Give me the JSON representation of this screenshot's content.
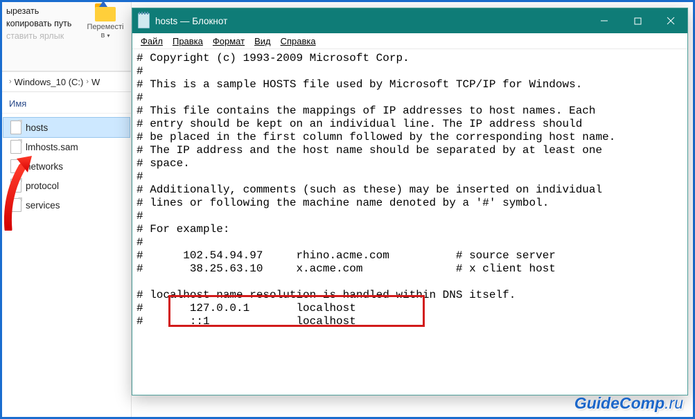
{
  "explorer": {
    "ribbon": {
      "cut": "ырезать",
      "copy_path": "копировать путь",
      "paste_shortcut": "ставить ярлык",
      "move_to": "Переместі",
      "move_to_line2": "в",
      "dropdown": "▾"
    },
    "breadcrumb": {
      "items": [
        "Windows_10 (C:)",
        "W"
      ]
    },
    "column_header": "Имя",
    "files": [
      {
        "name": "hosts",
        "type": "file",
        "selected": true
      },
      {
        "name": "lmhosts.sam",
        "type": "file",
        "selected": false
      },
      {
        "name": "networks",
        "type": "file",
        "selected": false
      },
      {
        "name": "protocol",
        "type": "file",
        "selected": false
      },
      {
        "name": "services",
        "type": "file",
        "selected": false
      }
    ]
  },
  "notepad": {
    "title": "hosts — Блокнот",
    "menu": [
      "Файл",
      "Правка",
      "Формат",
      "Вид",
      "Справка"
    ],
    "lines": [
      "# Copyright (c) 1993-2009 Microsoft Corp.",
      "#",
      "# This is a sample HOSTS file used by Microsoft TCP/IP for Windows.",
      "#",
      "# This file contains the mappings of IP addresses to host names. Each",
      "# entry should be kept on an individual line. The IP address should",
      "# be placed in the first column followed by the corresponding host name.",
      "# The IP address and the host name should be separated by at least one",
      "# space.",
      "#",
      "# Additionally, comments (such as these) may be inserted on individual",
      "# lines or following the machine name denoted by a '#' symbol.",
      "#",
      "# For example:",
      "#",
      "#      102.54.94.97     rhino.acme.com          # source server",
      "#       38.25.63.10     x.acme.com              # x client host",
      "",
      "# localhost name resolution is handled within DNS itself.",
      "#\t127.0.0.1       localhost",
      "#\t::1             localhost"
    ]
  },
  "watermark": {
    "brand": "GuideComp",
    "tld": ".ru"
  }
}
